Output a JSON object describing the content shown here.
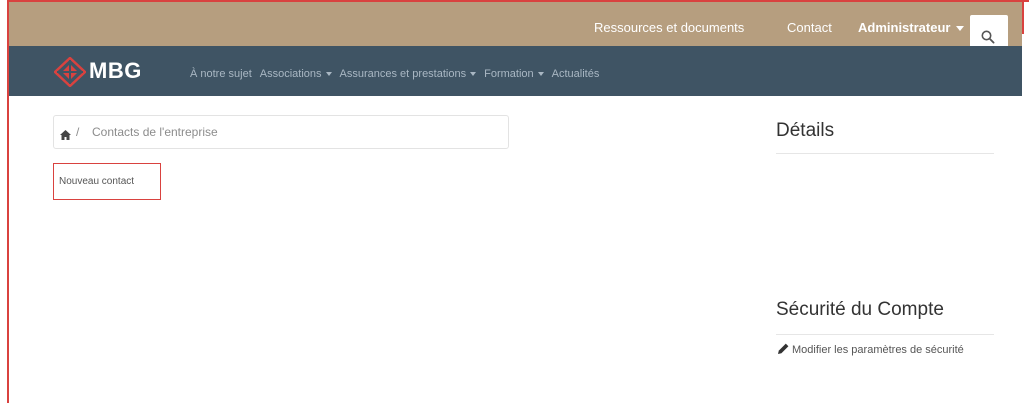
{
  "top_bar": {
    "resources_label": "Ressources et documents",
    "contact_label": "Contact",
    "admin_label": "Administrateur"
  },
  "nav": {
    "logo_text": "MBG",
    "items": [
      {
        "label": "À notre sujet",
        "has_caret": false
      },
      {
        "label": "Associations",
        "has_caret": true
      },
      {
        "label": "Assurances et prestations",
        "has_caret": true
      },
      {
        "label": "Formation",
        "has_caret": true
      },
      {
        "label": "Actualités",
        "has_caret": false
      }
    ]
  },
  "breadcrumb": {
    "separator": "/",
    "current": "Contacts de l'entreprise"
  },
  "actions": {
    "new_contact_label": "Nouveau contact"
  },
  "sidebar": {
    "details_title": "Détails",
    "security_title": "Sécurité du Compte",
    "modify_security_label": "Modifier les paramètres de sécurité"
  },
  "icons": {
    "search": "search-icon",
    "home": "home-icon",
    "logo": "diamond-logo-icon",
    "pencil": "pencil-icon"
  },
  "colors": {
    "utility_bar": "#b69e7f",
    "nav_bar": "#3f5464",
    "accent_red": "#d9423f"
  }
}
